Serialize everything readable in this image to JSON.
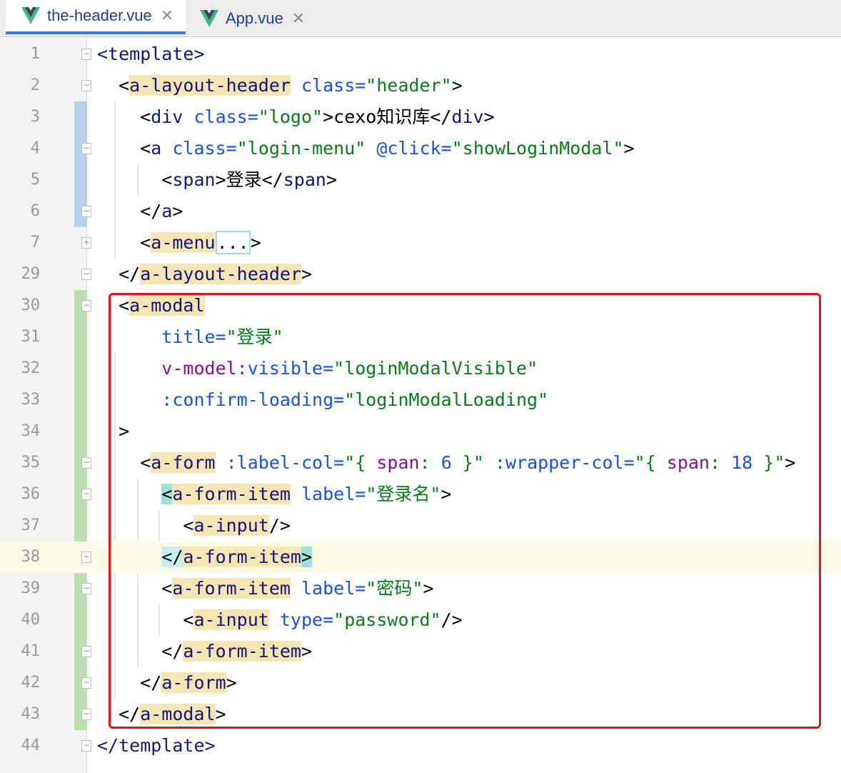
{
  "tabs": [
    {
      "label": "the-header.vue",
      "icon": "vue-icon",
      "active": true
    },
    {
      "label": "App.vue",
      "icon": "vue-icon",
      "active": false
    }
  ],
  "lines": [
    {
      "num": "1",
      "tokens": [
        {
          "t": "<template>",
          "c": "tg"
        }
      ]
    },
    {
      "num": "2",
      "tokens": [
        {
          "t": "  <"
        },
        {
          "t": "a-layout-header",
          "c": "tg hl"
        },
        {
          "t": " class=",
          "c": "at"
        },
        {
          "t": "\"header\"",
          "c": "st"
        },
        {
          "t": ">"
        }
      ]
    },
    {
      "num": "3",
      "tokens": [
        {
          "t": "    <"
        },
        {
          "t": "div",
          "c": "tg"
        },
        {
          "t": " class=",
          "c": "at"
        },
        {
          "t": "\"logo\"",
          "c": "st"
        },
        {
          "t": ">cexo知识库</"
        },
        {
          "t": "div",
          "c": "tg"
        },
        {
          "t": ">"
        }
      ]
    },
    {
      "num": "4",
      "tokens": [
        {
          "t": "    <"
        },
        {
          "t": "a",
          "c": "tg"
        },
        {
          "t": " class=",
          "c": "at"
        },
        {
          "t": "\"login-menu\"",
          "c": "st"
        },
        {
          "t": " @click=",
          "c": "at"
        },
        {
          "t": "\"showLoginModal\"",
          "c": "st"
        },
        {
          "t": ">"
        }
      ]
    },
    {
      "num": "5",
      "tokens": [
        {
          "t": "      <"
        },
        {
          "t": "span",
          "c": "tg"
        },
        {
          "t": ">登录</"
        },
        {
          "t": "span",
          "c": "tg"
        },
        {
          "t": ">"
        }
      ]
    },
    {
      "num": "6",
      "tokens": [
        {
          "t": "    </"
        },
        {
          "t": "a",
          "c": "tg"
        },
        {
          "t": ">"
        }
      ]
    },
    {
      "num": "7",
      "tokens": [
        {
          "t": "    <"
        },
        {
          "t": "a-menu",
          "c": "tg hl"
        },
        {
          "t": "...",
          "c": "fold"
        },
        {
          "t": ">"
        }
      ]
    },
    {
      "num": "29",
      "tokens": [
        {
          "t": "  </"
        },
        {
          "t": "a-layout-header",
          "c": "tg hl"
        },
        {
          "t": ">"
        }
      ]
    },
    {
      "num": "30",
      "tokens": [
        {
          "t": "  <"
        },
        {
          "t": "a-modal",
          "c": "tg hl"
        }
      ]
    },
    {
      "num": "31",
      "tokens": [
        {
          "t": "      title=",
          "c": "at"
        },
        {
          "t": "\"登录\"",
          "c": "st"
        }
      ]
    },
    {
      "num": "32",
      "tokens": [
        {
          "t": "      v-model:",
          "c": "vm"
        },
        {
          "t": "visible=",
          "c": "at"
        },
        {
          "t": "\"loginModalVisible\"",
          "c": "st"
        }
      ]
    },
    {
      "num": "33",
      "tokens": [
        {
          "t": "      :confirm-loading=",
          "c": "at"
        },
        {
          "t": "\"loginModalLoading\"",
          "c": "st"
        }
      ]
    },
    {
      "num": "34",
      "tokens": [
        {
          "t": "  >"
        }
      ]
    },
    {
      "num": "35",
      "tokens": [
        {
          "t": "    <"
        },
        {
          "t": "a-form",
          "c": "tg hl"
        },
        {
          "t": " :label-col=",
          "c": "at"
        },
        {
          "t": "\"{ ",
          "c": "st"
        },
        {
          "t": "span",
          "c": "kw"
        },
        {
          "t": ": ",
          "c": "st"
        },
        {
          "t": "6",
          "c": "nm"
        },
        {
          "t": " }\"",
          "c": "st"
        },
        {
          "t": " :wrapper-col=",
          "c": "at"
        },
        {
          "t": "\"{ ",
          "c": "st"
        },
        {
          "t": "span",
          "c": "kw"
        },
        {
          "t": ": ",
          "c": "st"
        },
        {
          "t": "18",
          "c": "nm"
        },
        {
          "t": " }\"",
          "c": "st"
        },
        {
          "t": ">"
        }
      ]
    },
    {
      "num": "36",
      "tokens": [
        {
          "t": "      "
        },
        {
          "t": "<",
          "c": "mt"
        },
        {
          "t": "a-form-item",
          "c": "tg hl"
        },
        {
          "t": " label=",
          "c": "at"
        },
        {
          "t": "\"登录名\"",
          "c": "st"
        },
        {
          "t": ">"
        }
      ]
    },
    {
      "num": "37",
      "tokens": [
        {
          "t": "        <"
        },
        {
          "t": "a-input",
          "c": "tg hl"
        },
        {
          "t": "/>"
        }
      ]
    },
    {
      "num": "38",
      "tokens": [
        {
          "t": "      "
        },
        {
          "t": "</",
          "c": "mt2"
        },
        {
          "t": "a-form-item",
          "c": "tg hl"
        },
        {
          "t": ">",
          "c": "mt"
        }
      ],
      "current": true
    },
    {
      "num": "39",
      "tokens": [
        {
          "t": "      <"
        },
        {
          "t": "a-form-item",
          "c": "tg hl"
        },
        {
          "t": " label=",
          "c": "at"
        },
        {
          "t": "\"密码\"",
          "c": "st"
        },
        {
          "t": ">"
        }
      ]
    },
    {
      "num": "40",
      "tokens": [
        {
          "t": "        <"
        },
        {
          "t": "a-input",
          "c": "tg hl"
        },
        {
          "t": " type=",
          "c": "at"
        },
        {
          "t": "\"password\"",
          "c": "st"
        },
        {
          "t": "/>"
        }
      ]
    },
    {
      "num": "41",
      "tokens": [
        {
          "t": "      </"
        },
        {
          "t": "a-form-item",
          "c": "tg hl"
        },
        {
          "t": ">"
        }
      ]
    },
    {
      "num": "42",
      "tokens": [
        {
          "t": "    </"
        },
        {
          "t": "a-form",
          "c": "tg hl"
        },
        {
          "t": ">"
        }
      ]
    },
    {
      "num": "43",
      "tokens": [
        {
          "t": "  </"
        },
        {
          "t": "a-modal",
          "c": "tg hl"
        },
        {
          "t": ">"
        }
      ]
    },
    {
      "num": "44",
      "tokens": [
        {
          "t": "</template>",
          "c": "tg"
        }
      ]
    }
  ],
  "fold_icons": [
    {
      "line": "1",
      "symbol": "−"
    },
    {
      "line": "2",
      "symbol": "−"
    },
    {
      "line": "4",
      "symbol": "−"
    },
    {
      "line": "6",
      "symbol": "−"
    },
    {
      "line": "7",
      "symbol": "+"
    },
    {
      "line": "29",
      "symbol": "−"
    },
    {
      "line": "30",
      "symbol": "−"
    },
    {
      "line": "35",
      "symbol": "−"
    },
    {
      "line": "36",
      "symbol": "−"
    },
    {
      "line": "38",
      "symbol": "−"
    },
    {
      "line": "39",
      "symbol": "−"
    },
    {
      "line": "41",
      "symbol": "−"
    },
    {
      "line": "42",
      "symbol": "−"
    },
    {
      "line": "43",
      "symbol": "−"
    },
    {
      "line": "44",
      "symbol": "−"
    }
  ],
  "colors": {
    "accent": "#3c7ae6",
    "selection_box": "#e8121e",
    "vcs_modified": "#b8d0ec",
    "vcs_added": "#bfddb5",
    "current_line": "#fcfae4"
  }
}
